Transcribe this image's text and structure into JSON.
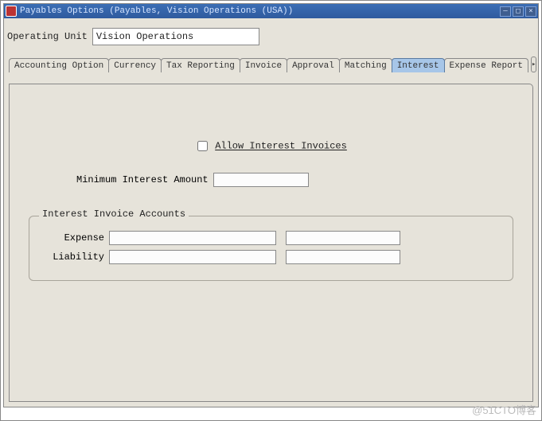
{
  "window": {
    "title": "Payables Options (Payables, Vision Operations (USA))"
  },
  "operating_unit": {
    "label": "Operating Unit",
    "value": "Vision Operations"
  },
  "tabs": [
    {
      "label": "Accounting Option"
    },
    {
      "label": "Currency"
    },
    {
      "label": "Tax Reporting"
    },
    {
      "label": "Invoice"
    },
    {
      "label": "Approval"
    },
    {
      "label": "Matching"
    },
    {
      "label": "Interest"
    },
    {
      "label": "Expense Report"
    }
  ],
  "active_tab_index": 6,
  "interest": {
    "allow_label": "Allow Interest Invoices",
    "allow_checked": false,
    "minimum_label": "Minimum Interest Amount",
    "minimum_value": "",
    "accounts_legend": "Interest Invoice Accounts",
    "expense_label": "Expense",
    "expense_code": "",
    "expense_desc": "",
    "liability_label": "Liability",
    "liability_code": "",
    "liability_desc": ""
  },
  "watermark": "@51CTO博客"
}
